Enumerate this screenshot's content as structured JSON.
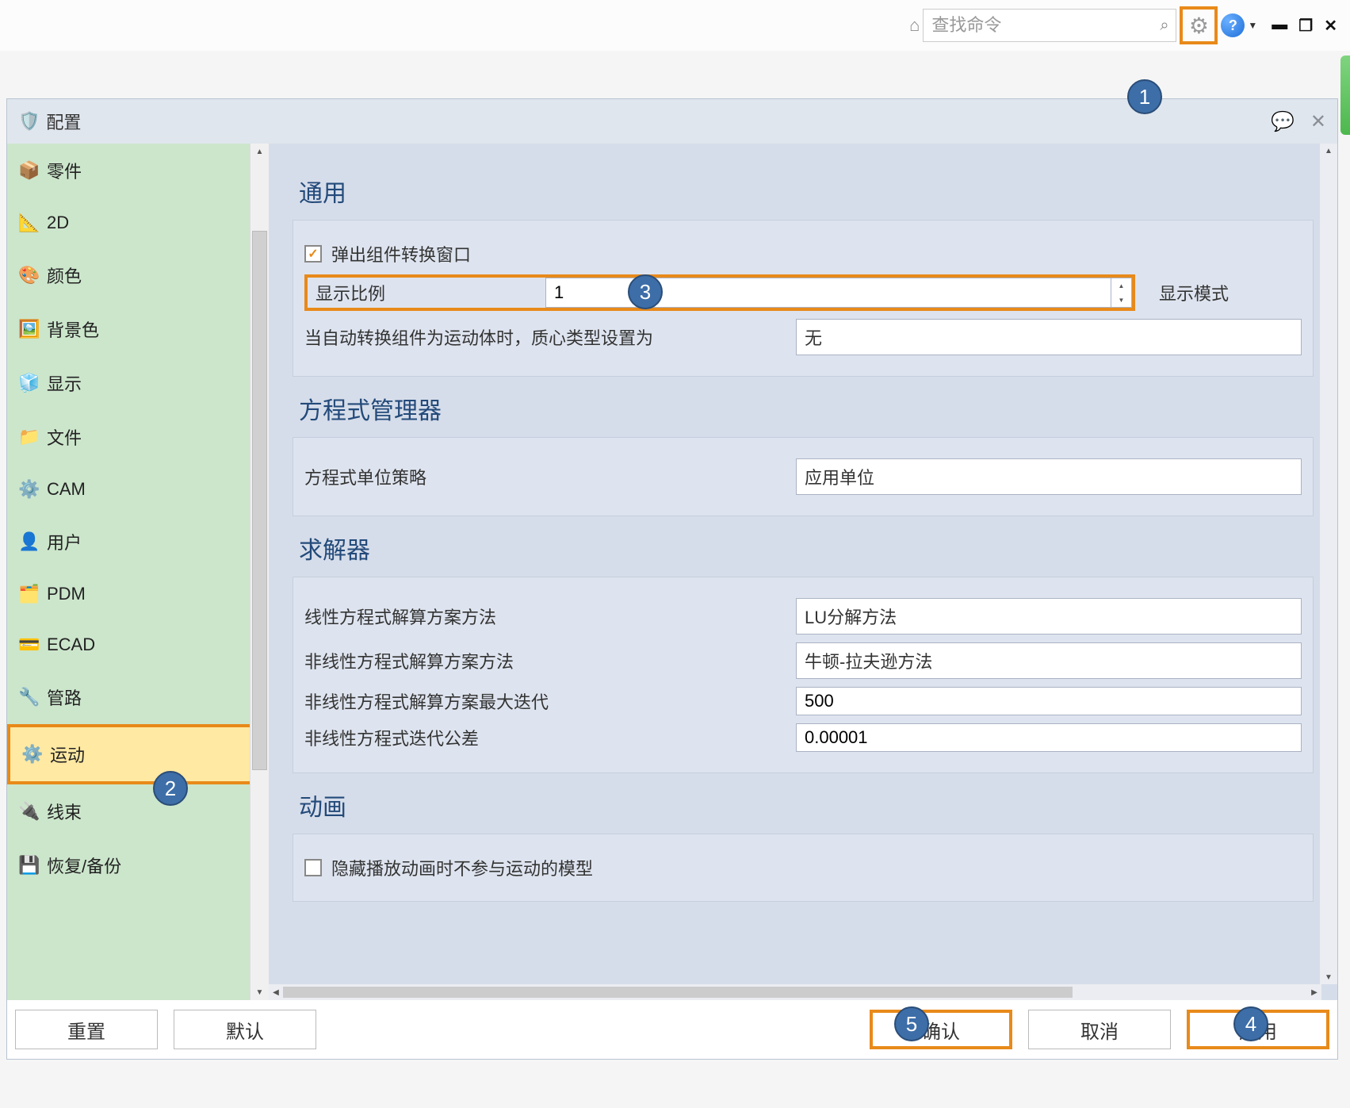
{
  "toolbar": {
    "search_placeholder": "查找命令"
  },
  "window": {
    "title": "配置"
  },
  "sidebar": {
    "items": [
      {
        "icon": "📦",
        "label": "零件"
      },
      {
        "icon": "📐",
        "label": "2D"
      },
      {
        "icon": "🎨",
        "label": "颜色"
      },
      {
        "icon": "🖼️",
        "label": "背景色"
      },
      {
        "icon": "🧊",
        "label": "显示"
      },
      {
        "icon": "📁",
        "label": "文件"
      },
      {
        "icon": "⚙️",
        "label": "CAM"
      },
      {
        "icon": "👤",
        "label": "用户"
      },
      {
        "icon": "🗂️",
        "label": "PDM"
      },
      {
        "icon": "💳",
        "label": "ECAD"
      },
      {
        "icon": "🔧",
        "label": "管路"
      },
      {
        "icon": "⚙️",
        "label": "运动"
      },
      {
        "icon": "🔌",
        "label": "线束"
      },
      {
        "icon": "💾",
        "label": "恢复/备份"
      }
    ],
    "selected_index": 11
  },
  "content": {
    "general": {
      "title": "通用",
      "popup_checkbox_label": "弹出组件转换窗口",
      "popup_checked": true,
      "scale_label": "显示比例",
      "scale_value": "1",
      "display_mode_label": "显示模式",
      "auto_convert_label": "当自动转换组件为运动体时，质心类型设置为",
      "auto_convert_value": "无"
    },
    "equation_manager": {
      "title": "方程式管理器",
      "unit_policy_label": "方程式单位策略",
      "unit_policy_value": "应用单位"
    },
    "solver": {
      "title": "求解器",
      "linear_method_label": "线性方程式解算方案方法",
      "linear_method_value": "LU分解方法",
      "nonlinear_method_label": "非线性方程式解算方案方法",
      "nonlinear_method_value": "牛顿-拉夫逊方法",
      "max_iter_label": "非线性方程式解算方案最大迭代",
      "max_iter_value": "500",
      "tolerance_label": "非线性方程式迭代公差",
      "tolerance_value": "0.00001"
    },
    "animation": {
      "title": "动画",
      "hide_checkbox_label": "隐藏播放动画时不参与运动的模型",
      "hide_checked": false
    }
  },
  "footer": {
    "reset": "重置",
    "default": "默认",
    "ok": "确认",
    "cancel": "取消",
    "apply": "应用"
  },
  "markers": {
    "m1": "1",
    "m2": "2",
    "m3": "3",
    "m4": "4",
    "m5": "5"
  }
}
